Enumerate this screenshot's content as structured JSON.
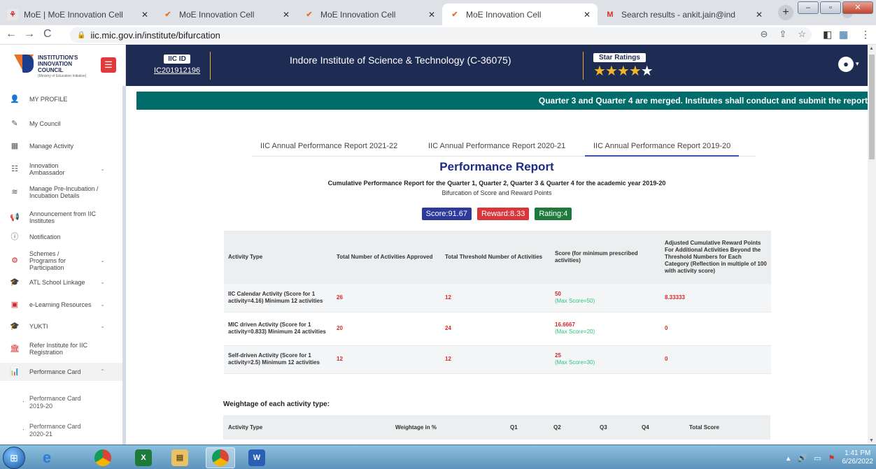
{
  "browser": {
    "tabs": [
      {
        "title": "MoE | MoE Innovation Cell",
        "favicon": "moe-icon",
        "left": 0
      },
      {
        "title": "MoE Innovation Cell",
        "favicon": "mic-icon"
      },
      {
        "title": "MoE Innovation Cell",
        "favicon": "mic-icon"
      },
      {
        "title": "MoE Innovation Cell",
        "favicon": "mic-icon"
      },
      {
        "title": "Search results - ankit.jain@ind",
        "favicon": "gmail-icon"
      }
    ],
    "url": "iic.mic.gov.in/institute/bifurcation"
  },
  "header": {
    "logo_text": "INSTITUTION'S INNOVATION COUNCIL",
    "logo_subtext": "(Ministry of Education Initiative)",
    "iic_id_label": "IIC ID",
    "iic_id": "IC201912196",
    "institute_name": "Indore Institute of Science & Technology (C-36075)",
    "star_label": "Star Ratings",
    "stars_filled": 4,
    "stars_total": 5
  },
  "sidebar": {
    "items": [
      {
        "label": "MY PROFILE",
        "icon": "user-icon"
      },
      {
        "label": "My Council",
        "icon": "edit-icon"
      },
      {
        "label": "Manage Activity",
        "icon": "table-icon"
      },
      {
        "label": "Innovation Ambassador",
        "icon": "list-icon"
      },
      {
        "label": "Manage Pre-Incubation / Incubation Details",
        "icon": "layers-icon"
      },
      {
        "label": "Announcement from IIC Institutes",
        "icon": "megaphone-icon"
      },
      {
        "label": "Notification",
        "icon": "info-icon"
      },
      {
        "label": "Schemes / Programs for Participation",
        "icon": "gears-icon"
      },
      {
        "label": "ATL School Linkage",
        "icon": "graduation-cap-icon"
      },
      {
        "label": "e-Learning Resources",
        "icon": "elearning-icon"
      },
      {
        "label": "YUKTI",
        "icon": "graduation-cap-icon"
      },
      {
        "label": "Refer Institute for IIC Registration",
        "icon": "institution-icon"
      },
      {
        "label": "Performance Card",
        "icon": "bar-chart-icon"
      }
    ],
    "subitems": [
      "Performance Card 2019-20",
      "Performance Card 2020-21"
    ]
  },
  "main": {
    "marquee": "Quarter 3 and Quarter 4 are merged. Institutes shall conduct and submit the report",
    "report_tabs": [
      "IIC Annual Performance Report 2021-22",
      "IIC Annual Performance Report 2020-21",
      "IIC Annual Performance Report 2019-20"
    ],
    "title": "Performance Report",
    "subtitle": "Cumulative Performance Report for the Quarter 1, Quarter 2, Quarter 3 & Quarter 4 for the academic year 2019-20",
    "subtitle2": "Bifurcation of Score and Reward Points",
    "score": "Score:91.67",
    "reward": "Reward:8.33",
    "rating": "Rating:4",
    "score_color": "#2b3a9b",
    "reward_color": "#d8363a",
    "rating_color": "#1e7a3a",
    "table": {
      "headers": [
        "Activity Type",
        "Total Number of Activities Approved",
        "Total Threshold Number of Activities",
        "Score (for minimum prescribed activities)",
        "Adjusted Cumulative Reward Points For Additional Activities Beyond the Threshold Numbers for Each Category (Reflection in multiple of 100 with activity score)"
      ],
      "rows": [
        {
          "activity": "IIC Calendar Activity (Score for 1 activity=4.16) Minimum 12 activities",
          "approved": "26",
          "threshold": "12",
          "score": "50",
          "max": "(Max Score=50)",
          "reward": "8.33333"
        },
        {
          "activity": "MIC driven Activity (Score for 1 activity=0.833) Minimum 24 activities",
          "approved": "20",
          "threshold": "24",
          "score": "16.6667",
          "max": "(Max Score=20)",
          "reward": "0"
        },
        {
          "activity": "Self-driven Activity (Score for 1 activity=2.5) Minimum 12 activities",
          "approved": "12",
          "threshold": "12",
          "score": "25",
          "max": "(Max Score=30)",
          "reward": "0"
        }
      ]
    },
    "weightage_label": "Weightage of each activity type:",
    "weightage_headers": [
      "Activity Type",
      "Weightage in %",
      "Q1",
      "Q2",
      "Q3",
      "Q4",
      "Total Score"
    ]
  },
  "taskbar": {
    "time": "1:41 PM",
    "date": "6/26/2022"
  }
}
